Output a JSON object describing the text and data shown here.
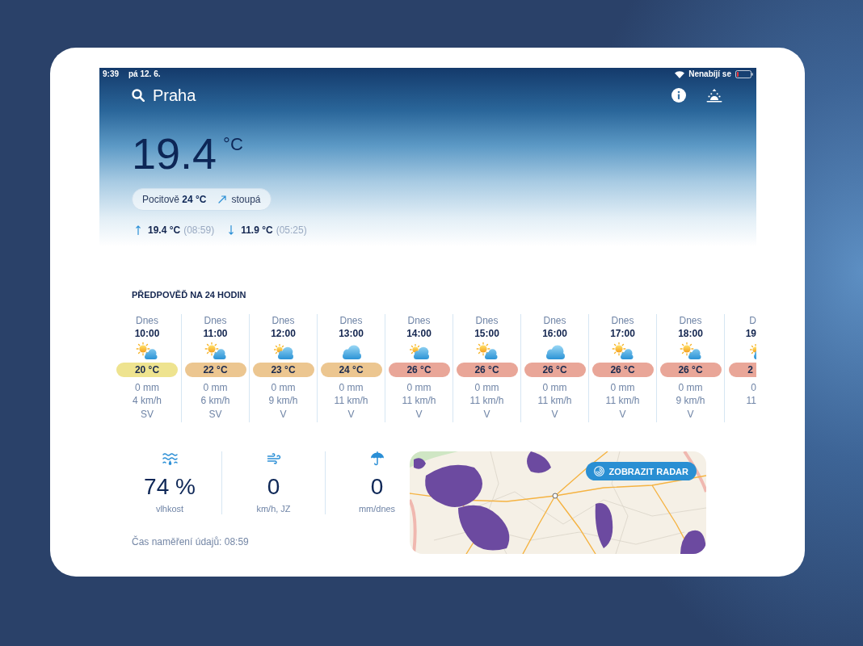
{
  "status_bar": {
    "time": "9:39",
    "date": "pá 12. 6.",
    "battery": "Nenabíjí se"
  },
  "header": {
    "location": "Praha",
    "temperature": "19.4",
    "unit": "°C",
    "feels_like": "Pocitově **24 °C**",
    "trend": "stoupá",
    "max": {
      "value": "19.4 °C",
      "time": "(08:59)"
    },
    "min": {
      "value": "11.9 °C",
      "time": "(05:25)"
    }
  },
  "forecast": {
    "title": "PŘEDPOVĚĎ NA 24 HODIN",
    "hours": [
      {
        "day": "Dnes",
        "time": "10:00",
        "kind": "mostly_sunny",
        "temp": "20 °C",
        "color": "#eee38f",
        "precip": "0 mm",
        "wind": "4 km/h",
        "direction": "SV"
      },
      {
        "day": "Dnes",
        "time": "11:00",
        "kind": "mostly_sunny",
        "temp": "22 °C",
        "color": "#ecc690",
        "precip": "0 mm",
        "wind": "6 km/h",
        "direction": "SV"
      },
      {
        "day": "Dnes",
        "time": "12:00",
        "kind": "partly_cloudy",
        "temp": "23 °C",
        "color": "#ecc690",
        "precip": "0 mm",
        "wind": "9 km/h",
        "direction": "V"
      },
      {
        "day": "Dnes",
        "time": "13:00",
        "kind": "cloudy",
        "temp": "24 °C",
        "color": "#ecc690",
        "precip": "0 mm",
        "wind": "11 km/h",
        "direction": "V"
      },
      {
        "day": "Dnes",
        "time": "14:00",
        "kind": "partly_cloudy",
        "temp": "26 °C",
        "color": "#e9a698",
        "precip": "0 mm",
        "wind": "11 km/h",
        "direction": "V"
      },
      {
        "day": "Dnes",
        "time": "15:00",
        "kind": "mostly_sunny",
        "temp": "26 °C",
        "color": "#e9a698",
        "precip": "0 mm",
        "wind": "11 km/h",
        "direction": "V"
      },
      {
        "day": "Dnes",
        "time": "16:00",
        "kind": "cloudy",
        "temp": "26 °C",
        "color": "#e9a698",
        "precip": "0 mm",
        "wind": "11 km/h",
        "direction": "V"
      },
      {
        "day": "Dnes",
        "time": "17:00",
        "kind": "mostly_sunny",
        "temp": "26 °C",
        "color": "#e9a698",
        "precip": "0 mm",
        "wind": "11 km/h",
        "direction": "V"
      },
      {
        "day": "Dnes",
        "time": "18:00",
        "kind": "mostly_sunny",
        "temp": "26 °C",
        "color": "#e9a698",
        "precip": "0 mm",
        "wind": "9 km/h",
        "direction": "V"
      },
      {
        "day": "D",
        "time": "19",
        "kind": "partly_cloudy",
        "temp": "2",
        "color": "#e9a698",
        "precip": "0",
        "wind": "11"
      }
    ]
  },
  "stats": [
    {
      "kind": "humidity",
      "value": "74 %",
      "label": "vlhkost"
    },
    {
      "kind": "wind",
      "value": "0",
      "label": "km/h, JZ"
    },
    {
      "kind": "precipitation",
      "value": "0",
      "label": "mm/dnes"
    }
  ],
  "measured_at": "Čas naměření údajů: 08:59",
  "radar": {
    "button": "ZOBRAZIT RADAR"
  }
}
